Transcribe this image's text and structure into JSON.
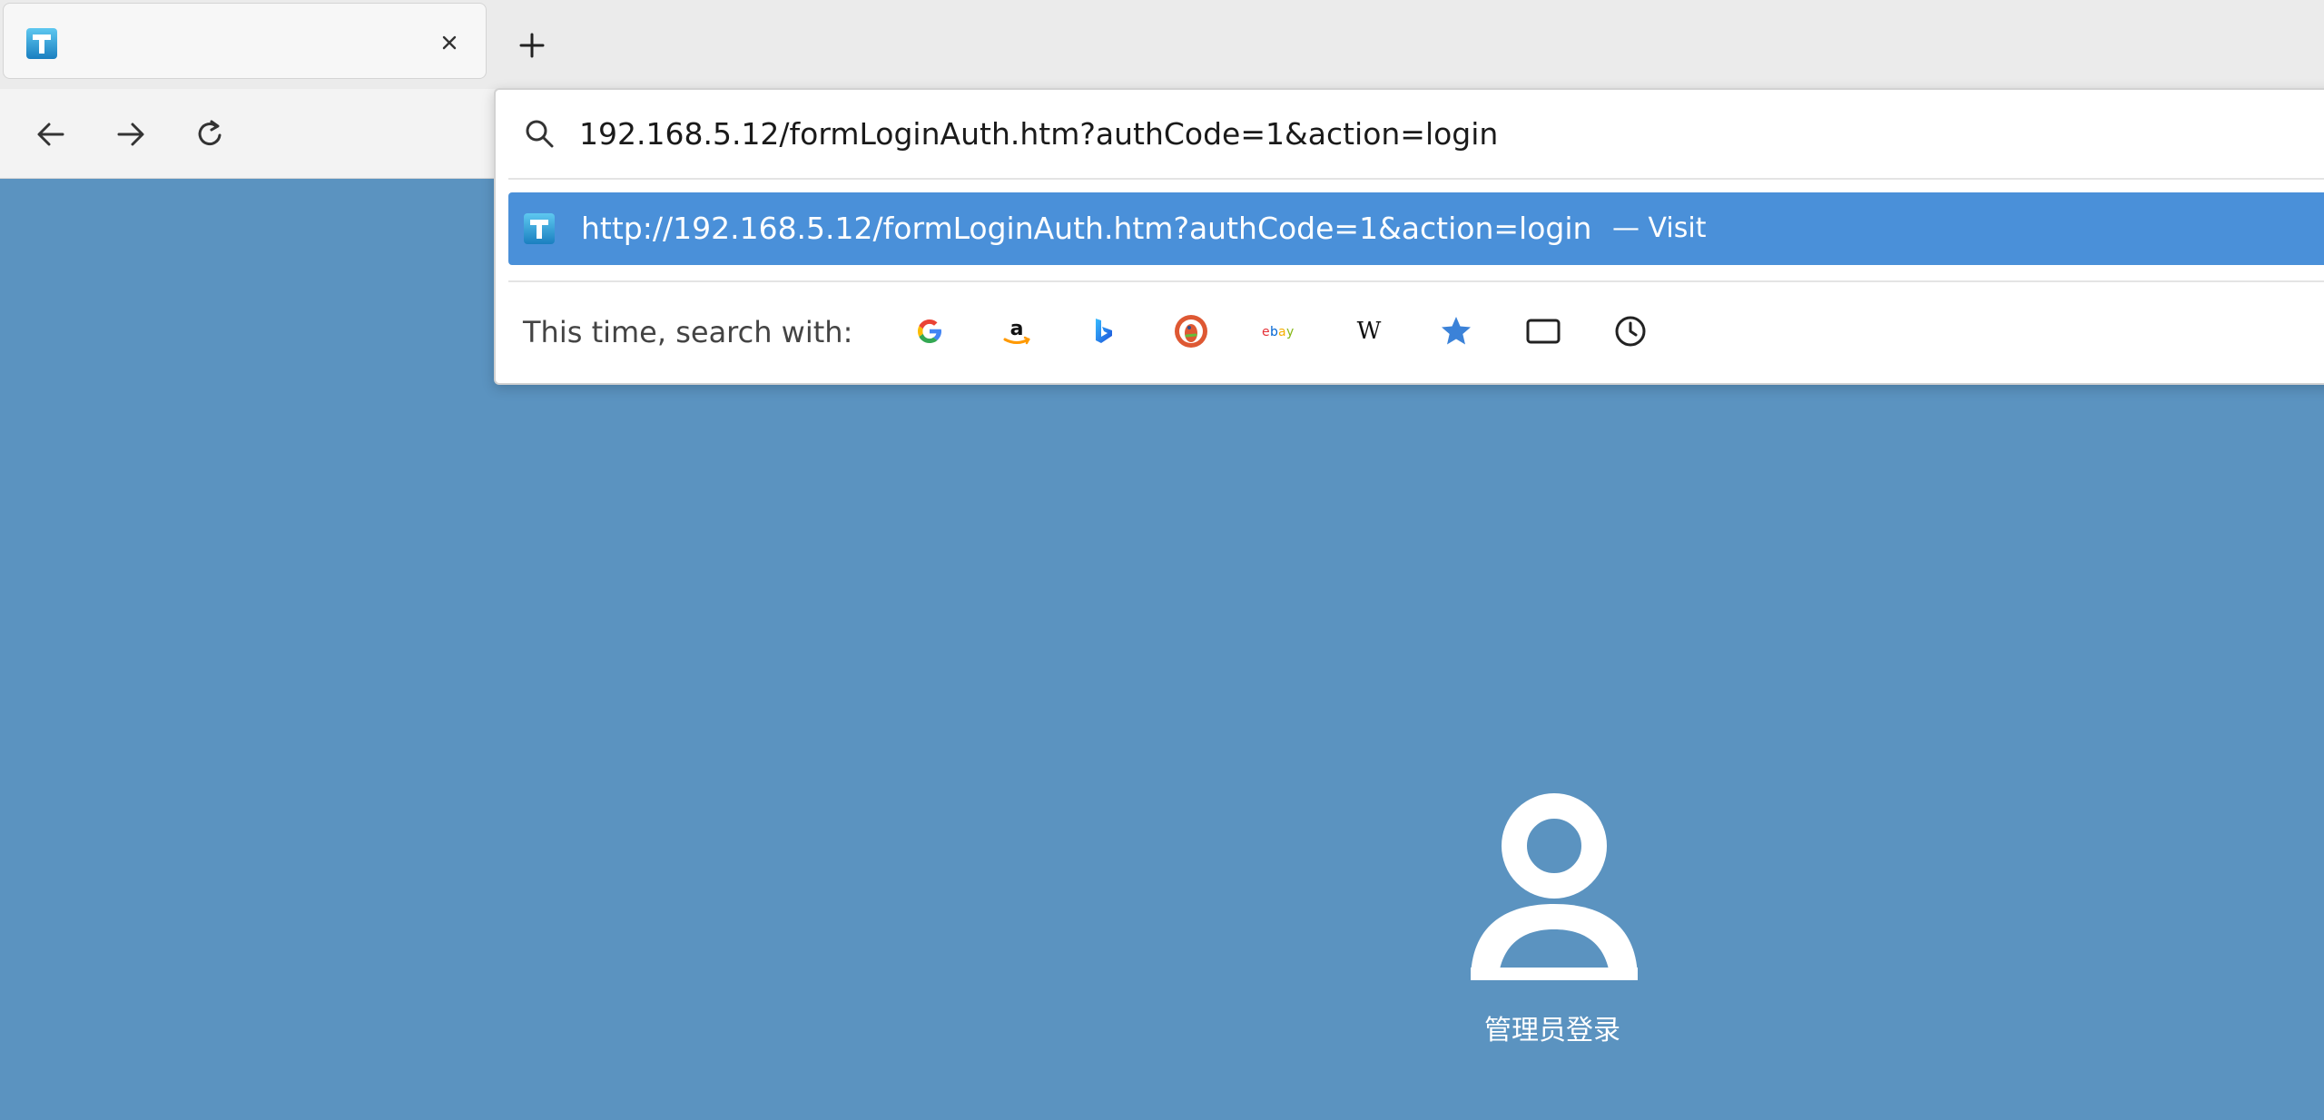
{
  "tab": {
    "title": "",
    "favicon": "t-logo-icon",
    "close_icon": "close-icon"
  },
  "new_tab_icon": "plus-icon",
  "nav": {
    "back_icon": "arrow-left-icon",
    "forward_icon": "arrow-right-icon",
    "reload_icon": "reload-icon"
  },
  "urlbar": {
    "value": "192.168.5.12/formLoginAuth.htm?authCode=1&action=login",
    "search_icon": "search-icon"
  },
  "suggestion": {
    "url": "http://192.168.5.12/formLoginAuth.htm?authCode=1&action=login",
    "action": "— Visit"
  },
  "search_engines": {
    "label": "This time, search with:",
    "items": [
      {
        "name": "google-icon"
      },
      {
        "name": "amazon-icon"
      },
      {
        "name": "bing-icon"
      },
      {
        "name": "duckduckgo-icon"
      },
      {
        "name": "ebay-icon"
      },
      {
        "name": "wikipedia-icon"
      },
      {
        "name": "bookmarks-star-icon"
      },
      {
        "name": "tabs-icon"
      },
      {
        "name": "history-clock-icon"
      }
    ]
  },
  "page": {
    "login_label": "管理员登录",
    "user_icon": "user-icon"
  },
  "colors": {
    "page_background": "#5b93c0",
    "suggestion_highlight": "#4a90d9",
    "tabstrip_background": "#ebebeb",
    "toolbar_background": "#f3f3f3"
  }
}
